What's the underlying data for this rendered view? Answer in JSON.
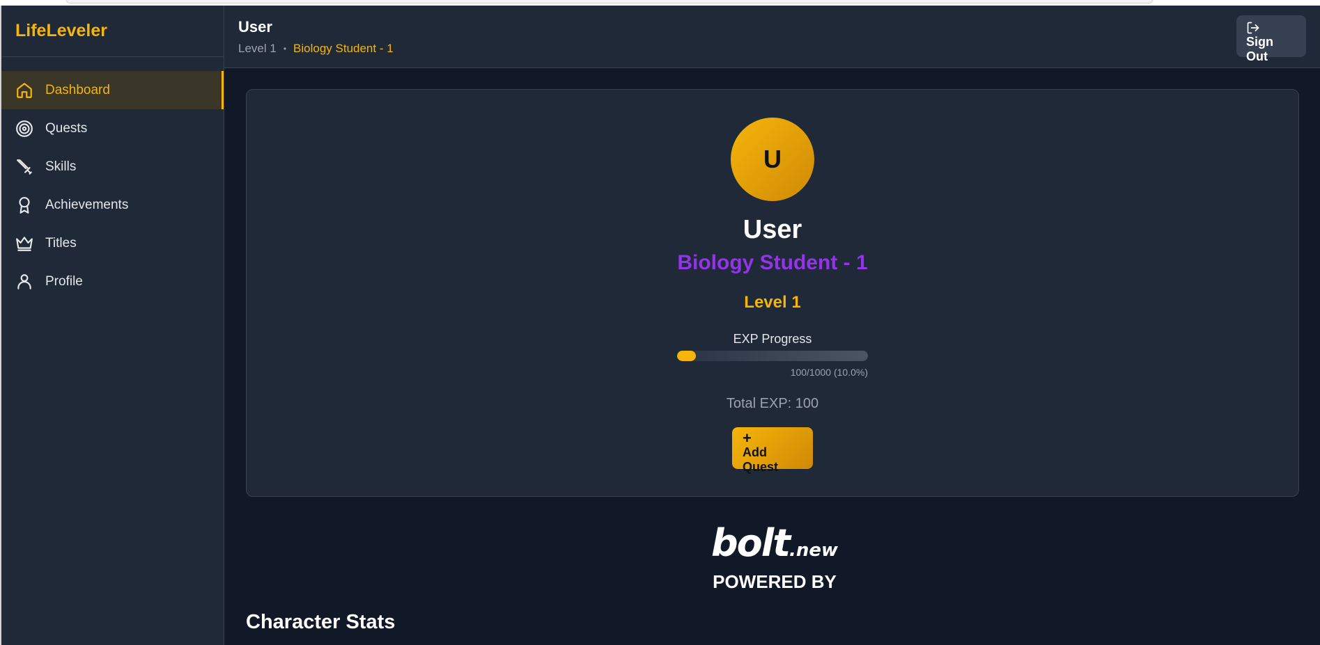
{
  "sidebar": {
    "brand": "LifeLeveler",
    "items": [
      {
        "label": "Dashboard",
        "icon": "home-icon",
        "active": true
      },
      {
        "label": "Quests",
        "icon": "target-icon",
        "active": false
      },
      {
        "label": "Skills",
        "icon": "sword-icon",
        "active": false
      },
      {
        "label": "Achievements",
        "icon": "award-icon",
        "active": false
      },
      {
        "label": "Titles",
        "icon": "crown-icon",
        "active": false
      },
      {
        "label": "Profile",
        "icon": "user-icon",
        "active": false
      }
    ]
  },
  "header": {
    "title": "User",
    "level": "Level 1",
    "separator": "•",
    "user_title": "Biology Student - 1",
    "sign_out": "Sign Out"
  },
  "profile": {
    "initial": "U",
    "name": "User",
    "title": "Biology Student - 1",
    "level": "Level 1",
    "exp_label": "EXP Progress",
    "exp_fraction": 0.1,
    "exp_text": "100/1000 (10.0%)",
    "total_exp": "Total EXP: 100",
    "add_quest": "Add Quest",
    "add_quest_icon": "+"
  },
  "badge": {
    "logo_main": "bolt",
    "logo_suffix": ".new",
    "powered": "POWERED BY"
  },
  "sections": {
    "stats_title": "Character Stats"
  },
  "colors": {
    "accent": "#f5b50a",
    "title_purple": "#9333ea",
    "background": "#111827",
    "panel": "#1f2937"
  }
}
